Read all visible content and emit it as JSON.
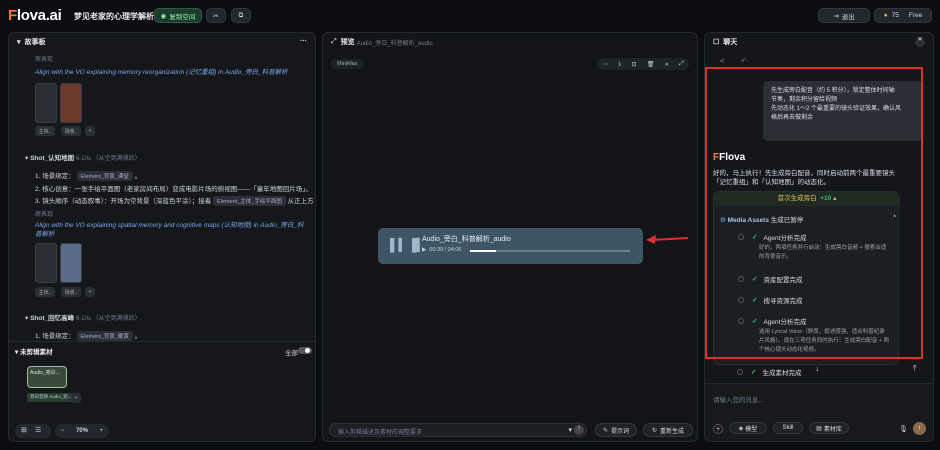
{
  "header": {
    "logo_prefix": "F",
    "logo_rest": "lova.ai",
    "project_title": "梦见老家的心理学解析",
    "share_label": "复制空间",
    "exit_label": "退出",
    "credits": "75",
    "plan": "Free"
  },
  "storyboard": {
    "title": "故事板",
    "more": "···",
    "blocks": [
      {
        "label": "原表现",
        "note": "Align with the VO explaining memory reorganization (记忆重组) in Audio_旁白_科普解析"
      },
      {
        "shot": "Shot_认知地图",
        "dur": "6-10s （从空到满铺后）",
        "items": [
          "1. 场景绑定：",
          "2. 核心创意：一张手绘平面图（老家房间布局）变成电影片场的俯视图——「童年地图回片场」。",
          "3. 镜头顺序（动态叙事）：开场为空背景（深蓝色平涂）；接着"
        ],
        "tag1": "Element_背景_课堂",
        "tag2": "Element_主体_手绘平面图",
        "tail": "从正上方"
      },
      {
        "label": "原表现",
        "note": "Align with the VO explaining spatial memory and cognitive maps (认知地图) in Audio_旁白_科普解析"
      },
      {
        "shot": "Shot_回忆高峰",
        "dur": "6-10s （从空到满铺后）",
        "items": [
          "1. 场景绑定："
        ],
        "tag1": "Element_背景_暖黄"
      }
    ],
    "chips": [
      "主体..",
      "场景.."
    ],
    "add": "+"
  },
  "materials": {
    "title": "未剪辑素材",
    "toggle_label": "全部",
    "card_title": "Audio_旁白...",
    "card_tag": "旁白音频 Audio_旁...",
    "zoom": "70%"
  },
  "preview": {
    "title": "预览",
    "file": "Audio_旁白_科普解析_audio",
    "badge": "MiniMax",
    "audio_title": "Audio_旁白_科普解析_audio",
    "time": "00:39 / 04:06",
    "progress": 0.16,
    "input_placeholder": "输入剪辑描述及素材的调整要求",
    "prompt_btn": "提示词",
    "generate_btn": "重新生成"
  },
  "chat": {
    "title": "聊天",
    "user_msg": [
      "先生成旁白配音（约 5 积分），锁定整体时间轴",
      "节奏，剩余积分留给视频",
      "先动态化 1～2 个最重要的镜头验证效果，确认风",
      "格后再去做剩余"
    ],
    "bot_name": "Flova",
    "bot_msg": [
      "好的，马上执行！先生成旁白配音，同时启动前两个最重要镜头",
      "「记忆重组」和「认知地图」的动态化。"
    ],
    "task_label": "首次生成旁白",
    "task_points": "+10",
    "assets_title": "Media Assets",
    "assets_status": "生成已暂停",
    "steps": [
      {
        "label": "Agent分析完成",
        "detail": [
          "好的，两項任务并行启动：生成旁白音频 + 搜索合适",
          "的背景音乐。"
        ]
      },
      {
        "label": "资産配置完成"
      },
      {
        "label": "搜寻资源完成"
      },
      {
        "label": "Agent分析完成",
        "detail": [
          "选用 Lyrical Voice（舒厚，叙述感强，适合科普纪录",
          "片风格）。现在三项任务同时执行：生成旁白配音 + 两",
          "个核心镜头动态化视频。"
        ]
      },
      {
        "label": "生成素材完成"
      }
    ],
    "input_placeholder": "请输入您的讯息...",
    "model_label": "模型",
    "skill_label": "Skill",
    "assets_label": "素材库"
  },
  "colors": {
    "accent": "#ff7a30",
    "green": "#35c46b",
    "highlight": "#e02e2e",
    "player": "#3e5566"
  }
}
